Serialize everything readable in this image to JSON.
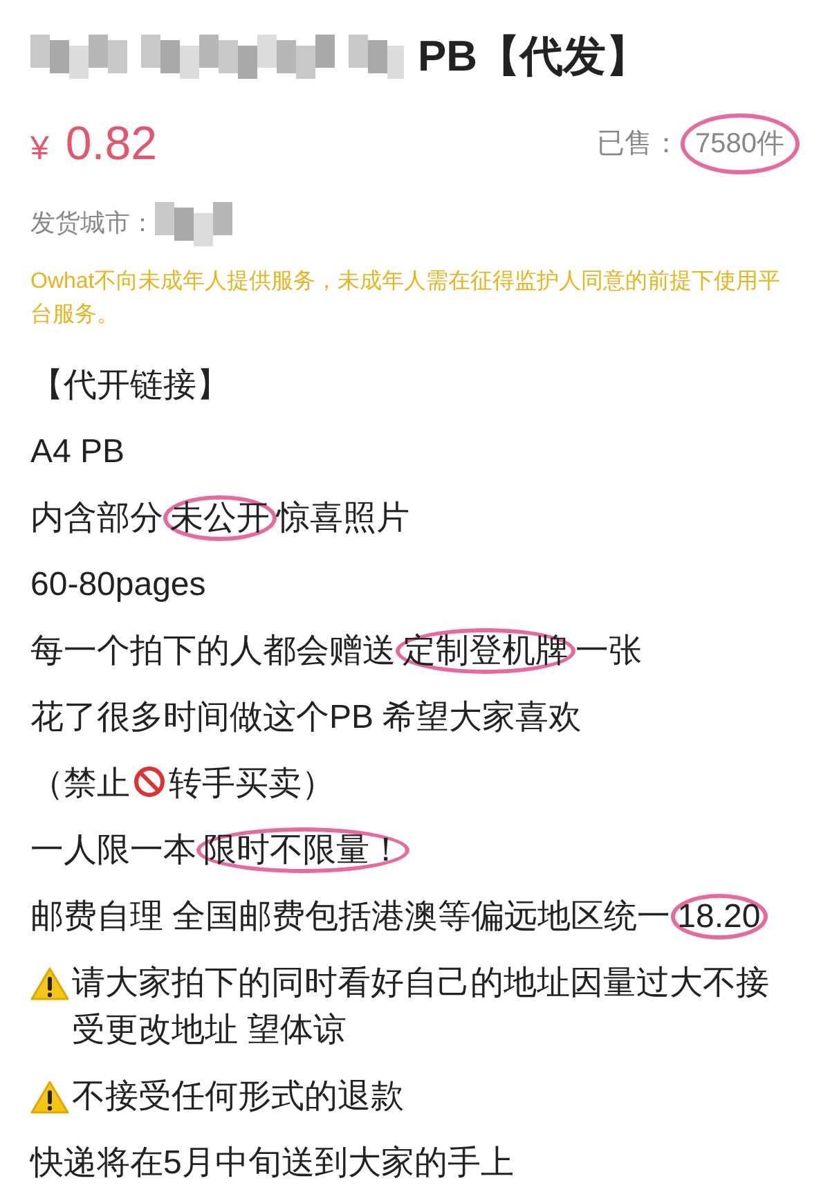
{
  "title": {
    "text": "PB【代发】"
  },
  "price": {
    "currency": "¥",
    "amount": "0.82"
  },
  "sold": {
    "label": "已售：",
    "count": "7580件",
    "circled": true
  },
  "ship_city": {
    "label": "发货城市："
  },
  "notice": "Owhat不向未成年人提供服务，未成年人需在征得监护人同意的前提下使用平台服务。",
  "description": [
    {
      "parts": [
        {
          "kind": "text",
          "text": "【代开链接】",
          "circled": false
        }
      ]
    },
    {
      "parts": [
        {
          "kind": "text",
          "text": "A4 PB",
          "circled": false
        }
      ]
    },
    {
      "parts": [
        {
          "kind": "text",
          "text": "内含部分",
          "circled": false
        },
        {
          "kind": "text",
          "text": "未公开",
          "circled": true
        },
        {
          "kind": "text",
          "text": "惊喜照片",
          "circled": false
        }
      ]
    },
    {
      "parts": [
        {
          "kind": "text",
          "text": "60-80pages",
          "circled": false
        }
      ]
    },
    {
      "parts": [
        {
          "kind": "text",
          "text": "每一个拍下的人都会赠送",
          "circled": false
        },
        {
          "kind": "text",
          "text": "定制登机牌",
          "circled": true
        },
        {
          "kind": "text",
          "text": "一张",
          "circled": false
        }
      ]
    },
    {
      "parts": [
        {
          "kind": "text",
          "text": "花了很多时间做这个PB 希望大家喜欢",
          "circled": false
        }
      ]
    },
    {
      "parts": [
        {
          "kind": "text",
          "text": "（禁止",
          "circled": false
        },
        {
          "kind": "prohibited"
        },
        {
          "kind": "text",
          "text": "转手买卖）",
          "circled": false
        }
      ]
    },
    {
      "parts": [
        {
          "kind": "text",
          "text": "一人限一本",
          "circled": false
        },
        {
          "kind": "text",
          "text": "限时不限量！",
          "circled": true
        }
      ]
    },
    {
      "parts": [
        {
          "kind": "text",
          "text": "邮费自理 全国邮费包括港澳等偏远地区统一",
          "circled": false
        },
        {
          "kind": "text",
          "text": "18.20",
          "circled": true
        }
      ]
    },
    {
      "parts": [
        {
          "kind": "warning"
        },
        {
          "kind": "text",
          "text": "请大家拍下的同时看好自己的地址因量过大不接受更改地址 望体谅",
          "circled": false
        }
      ]
    },
    {
      "parts": [
        {
          "kind": "warning"
        },
        {
          "kind": "text",
          "text": "不接受任何形式的退款",
          "circled": false
        }
      ]
    },
    {
      "parts": [
        {
          "kind": "text",
          "text": "快递将在5月中旬送到大家的手上",
          "circled": false
        }
      ]
    }
  ]
}
